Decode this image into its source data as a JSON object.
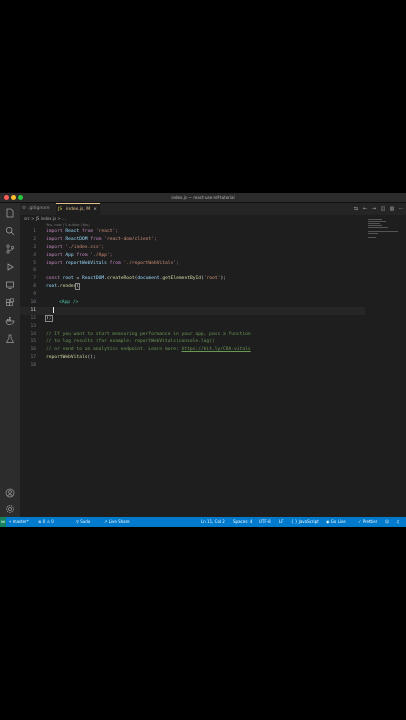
{
  "window": {
    "title": "index.js — react-use-ref-tutorial"
  },
  "tabs": [
    {
      "label": ".gitignore",
      "icon": "gear-icon"
    },
    {
      "label": "index.js, M",
      "icon": "js-file-icon",
      "close": "×"
    }
  ],
  "breadcrumb": "src > JS index.js > ...",
  "blame": "You, now | 1 author (You)",
  "code": {
    "line_numbers": [
      "1",
      "2",
      "3",
      "4",
      "5",
      "6",
      "7",
      "8",
      "9",
      "10",
      "11",
      "12",
      "13",
      "14",
      "15",
      "16",
      "17",
      "18"
    ],
    "current_line": 11,
    "lines": {
      "l1": {
        "kw": "import",
        "id": "React",
        "from": "from",
        "str": "'react';"
      },
      "l2": {
        "kw": "import",
        "id": "ReactDOM",
        "from": "from",
        "str": "'react-dom/client';"
      },
      "l3": {
        "kw": "import",
        "str": "'./index.css';"
      },
      "l4": {
        "kw": "import",
        "id": "App",
        "from": "from",
        "str": "'./App';"
      },
      "l5": {
        "kw": "import",
        "id": "reportWebVitals",
        "from": "from",
        "str": "'./reportWebVitals';"
      },
      "l7": {
        "kw": "const",
        "id": "root",
        "eq": " = ",
        "obj": "ReactDOM",
        "dot": ".",
        "fn": "createRoot",
        "open": "(",
        "obj2": "document",
        "dot2": ".",
        "fn2": "getElementById",
        "arg": "'root'",
        "close": ");"
      },
      "l8": {
        "obj": "root",
        "dot": ".",
        "fn": "render",
        "open": "("
      },
      "l10": {
        "tag": "<App />"
      },
      "l12": {
        "close": ");"
      },
      "l14": {
        "comment": "// If you want to start measuring performance in your app, pass a function"
      },
      "l15": {
        "comment": "// to log results (for example: reportWebVitals(console.log))"
      },
      "l16": {
        "comment": "// or send to an analytics endpoint. Learn more: ",
        "link": "https://bit.ly/CRA-vitals"
      },
      "l17": {
        "fn": "reportWebVitals",
        "close": "();"
      }
    }
  },
  "status": {
    "branch": "master*",
    "errors": "⊗ 0 ⚠ 0",
    "sudo": "Sudo",
    "live_share": "Live Share",
    "position": "Ln 11, Col 2",
    "spaces": "Spaces: 4",
    "encoding": "UTF-8",
    "eol": "LF",
    "language": "JavaScript",
    "go_live": "Go Live",
    "prettier": "✓ Prettier"
  },
  "colors": {
    "status_bar": "#007acc",
    "editor_bg": "#1e1e1e",
    "activity_bar": "#2c2c2c"
  }
}
